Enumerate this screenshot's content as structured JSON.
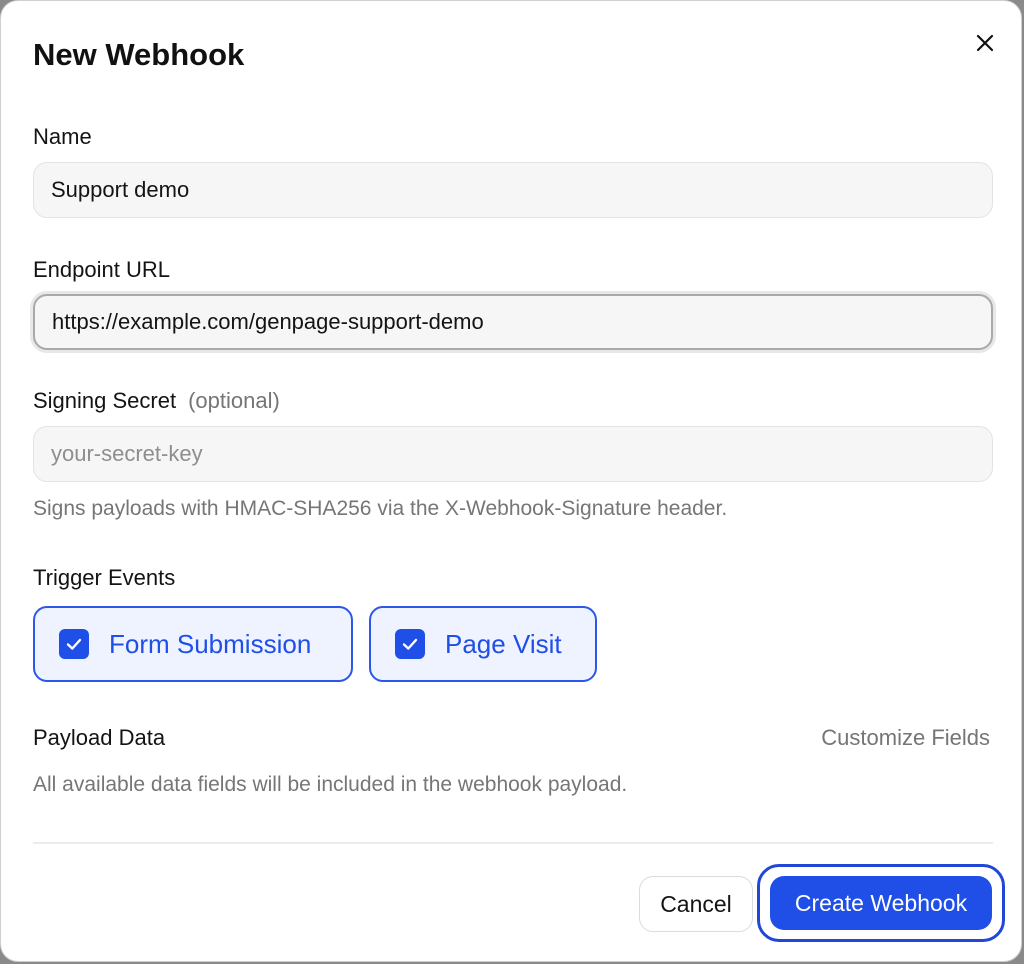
{
  "dialog": {
    "title": "New Webhook",
    "close_icon": "close-icon"
  },
  "name": {
    "label": "Name",
    "value": "Support demo",
    "placeholder": ""
  },
  "endpoint": {
    "label": "Endpoint URL",
    "value": "https://example.com/genpage-support-demo",
    "placeholder": ""
  },
  "secret": {
    "label": "Signing Secret",
    "optional": "(optional)",
    "value": "",
    "placeholder": "your-secret-key",
    "hint": "Signs payloads with HMAC-SHA256 via the X-Webhook-Signature header."
  },
  "trigger_events": {
    "label": "Trigger Events",
    "options": [
      {
        "label": "Form Submission",
        "checked": true
      },
      {
        "label": "Page Visit",
        "checked": true
      }
    ]
  },
  "payload": {
    "label": "Payload Data",
    "customize_link": "Customize Fields",
    "description": "All available data fields will be included in the webhook payload."
  },
  "footer": {
    "cancel_label": "Cancel",
    "create_label": "Create Webhook"
  },
  "colors": {
    "accent": "#1f4fe6",
    "chip_background": "#eef3ff",
    "muted_text": "#767676"
  }
}
